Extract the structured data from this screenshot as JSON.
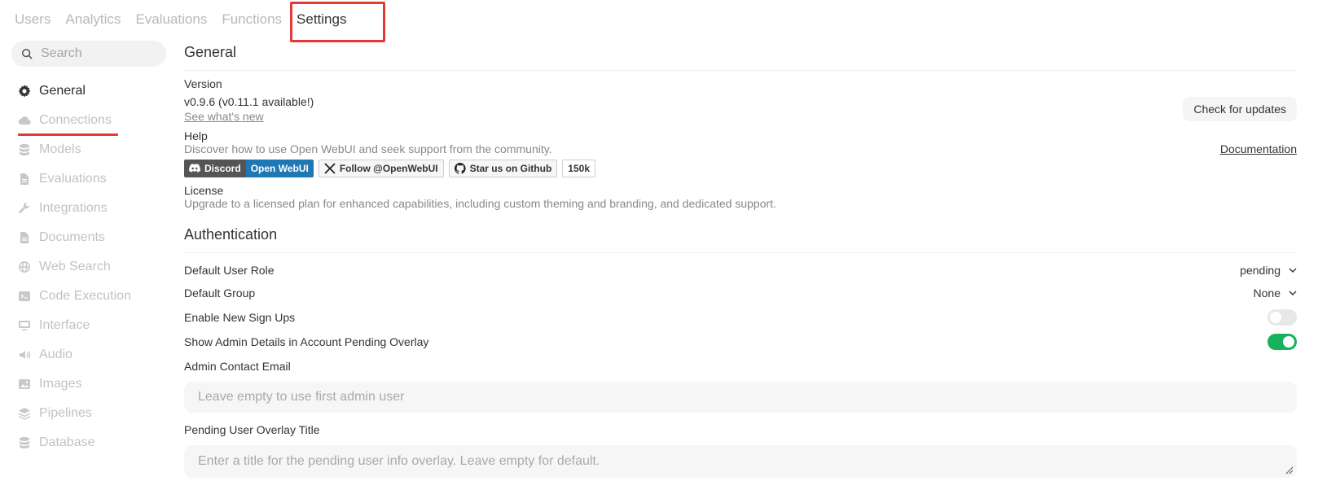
{
  "topnav": {
    "tabs": [
      {
        "label": "Users"
      },
      {
        "label": "Analytics"
      },
      {
        "label": "Evaluations"
      },
      {
        "label": "Functions"
      },
      {
        "label": "Settings"
      }
    ]
  },
  "sidebar": {
    "search_placeholder": "Search",
    "items": [
      {
        "label": "General",
        "icon": "gear-icon"
      },
      {
        "label": "Connections",
        "icon": "cloud-icon"
      },
      {
        "label": "Models",
        "icon": "database-icon"
      },
      {
        "label": "Evaluations",
        "icon": "document-icon"
      },
      {
        "label": "Integrations",
        "icon": "wrench-icon"
      },
      {
        "label": "Documents",
        "icon": "document-icon"
      },
      {
        "label": "Web Search",
        "icon": "globe-icon"
      },
      {
        "label": "Code Execution",
        "icon": "terminal-icon"
      },
      {
        "label": "Interface",
        "icon": "monitor-icon"
      },
      {
        "label": "Audio",
        "icon": "speaker-icon"
      },
      {
        "label": "Images",
        "icon": "image-icon"
      },
      {
        "label": "Pipelines",
        "icon": "layers-icon"
      },
      {
        "label": "Database",
        "icon": "database-icon"
      }
    ]
  },
  "general": {
    "title": "General",
    "version_label": "Version",
    "version_value": "v0.9.6 (v0.11.1 available!)",
    "whats_new": "See what's new",
    "check_updates": "Check for updates",
    "help_label": "Help",
    "help_text": "Discover how to use Open WebUI and seek support from the community.",
    "documentation": "Documentation",
    "badges": {
      "discord_left": "Discord",
      "discord_right": "Open WebUI",
      "x": "Follow @OpenWebUI",
      "github": "Star us on Github",
      "count": "150k"
    },
    "license_label": "License",
    "license_text": "Upgrade to a licensed plan for enhanced capabilities, including custom theming and branding, and dedicated support."
  },
  "auth": {
    "title": "Authentication",
    "default_role_label": "Default User Role",
    "default_role_value": "pending",
    "default_group_label": "Default Group",
    "default_group_value": "None",
    "signups_label": "Enable New Sign Ups",
    "signups_enabled": false,
    "admin_details_label": "Show Admin Details in Account Pending Overlay",
    "admin_details_enabled": true,
    "admin_email_label": "Admin Contact Email",
    "admin_email_placeholder": "Leave empty to use first admin user",
    "overlay_title_label": "Pending User Overlay Title",
    "overlay_title_placeholder": "Enter a title for the pending user info overlay. Leave empty for default."
  },
  "colors": {
    "accent_green": "#16b15b",
    "highlight_red": "#e53935",
    "discord_blue": "#1f77b4"
  }
}
